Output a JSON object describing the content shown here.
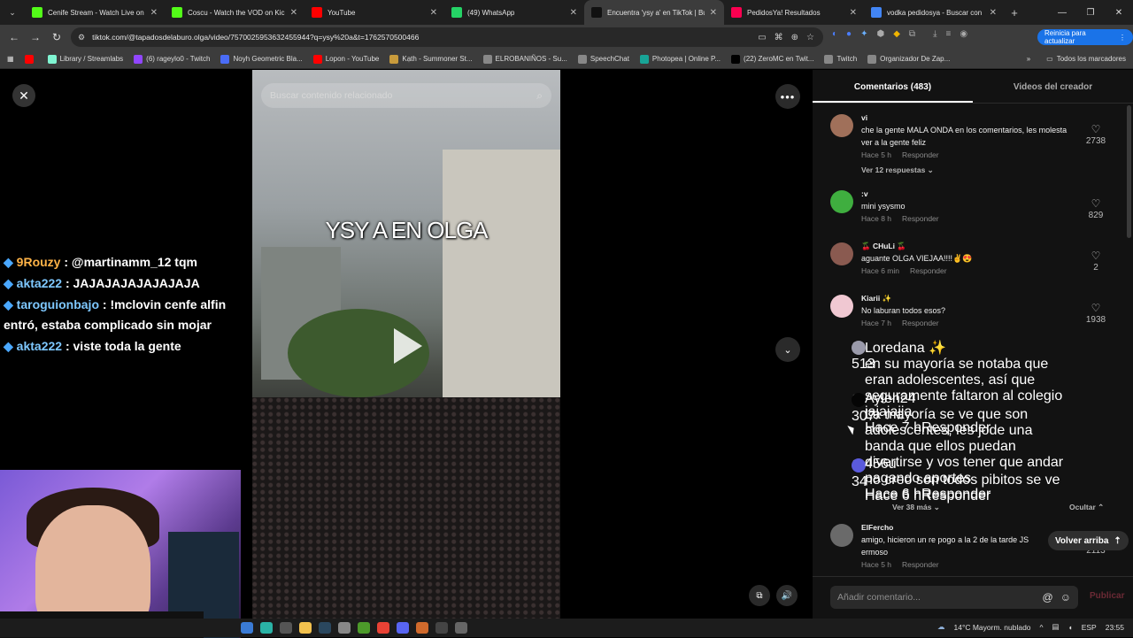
{
  "tabs": [
    {
      "title": "Cenife Stream - Watch Live on",
      "color": "#53fc18",
      "active": false
    },
    {
      "title": "Coscu - Watch the VOD on Kick",
      "color": "#53fc18",
      "active": false
    },
    {
      "title": "YouTube",
      "color": "#ff0000",
      "active": false
    },
    {
      "title": "(49) WhatsApp",
      "color": "#25d366",
      "active": false
    },
    {
      "title": "Encuentra 'ysy a' en TikTok | Bu",
      "color": "#111111",
      "active": true
    },
    {
      "title": "PedidosYa! Resultados",
      "color": "#fa0050",
      "active": false
    },
    {
      "title": "vodka pedidosya - Buscar con",
      "color": "#4285f4",
      "active": false
    }
  ],
  "address": {
    "url": "tiktok.com/@tapadosdelaburo.olga/video/7570025953632455944?q=ysy%20a&t=1762570500466",
    "update_label": "Reinicia para actualizar"
  },
  "bookmarks": [
    {
      "label": "",
      "color": "#ff0000"
    },
    {
      "label": "Library / Streamlabs",
      "color": "#80f5d2"
    },
    {
      "label": "(6) rageylo0 - Twitch",
      "color": "#9146ff"
    },
    {
      "label": "Noyh Geometric Bla...",
      "color": "#4a6cf7"
    },
    {
      "label": "Lopon - YouTube",
      "color": "#ff0000"
    },
    {
      "label": "Kạth - Summoner St...",
      "color": "#c89b3c"
    },
    {
      "label": "ELROBANIÑOS - Su...",
      "color": "#888888"
    },
    {
      "label": "SpeechChat",
      "color": "#888888"
    },
    {
      "label": "Photopea | Online P...",
      "color": "#18a497"
    },
    {
      "label": "(22) ZeroMC en Twit...",
      "color": "#000000"
    },
    {
      "label": "Twitch",
      "color": "#888888"
    },
    {
      "label": "Organizador De Zap...",
      "color": "#888888"
    }
  ],
  "bookmarks_all": "Todos los marcadores",
  "stream_chat": [
    {
      "user": "9Rouzy",
      "msg": "@martinamm_12 tqm",
      "gold": true
    },
    {
      "user": "akta222",
      "msg": "JAJAJAJAJAJAJAJA",
      "gold": false
    },
    {
      "user": "taroguionbajo",
      "msg": "!mclovin cenfe alfin entró, estaba complicado sin mojar",
      "gold": false
    },
    {
      "user": "akta222",
      "msg": "viste toda la gente",
      "gold": false
    }
  ],
  "video": {
    "search_placeholder": "Buscar contenido relacionado",
    "caption": "YSY A EN OLGA"
  },
  "panel": {
    "tab_comments": "Comentarios (483)",
    "tab_videos": "Videos del creador",
    "reply_label": "Responder",
    "back_to_top": "Volver arriba",
    "comment_placeholder": "Añadir comentario...",
    "publish": "Publicar"
  },
  "comments": [
    {
      "name": "vi",
      "text": "che la gente MALA ONDA en los comentarios, les molesta ver a la gente feliz",
      "time": "Hace 5 h",
      "likes": "2738",
      "avatar": "#a0705a",
      "view": "Ver 12 respuestas"
    },
    {
      "name": ":v",
      "text": "mini ysysmo",
      "time": "Hace 8 h",
      "likes": "829",
      "avatar": "#3fae3f",
      "view": ""
    },
    {
      "name": "🍒 CHuLi 🍒",
      "text": "aguante OLGA VIEJAA!!!!✌️😍",
      "time": "Hace 6 min",
      "likes": "2",
      "avatar": "#8a5a50",
      "view": ""
    },
    {
      "name": "Kiarii ✨",
      "text": "No laburan todos esos?",
      "time": "Hace 7 h",
      "likes": "1938",
      "avatar": "#f0c8d2",
      "view": ""
    },
    {
      "name": "ElFercho",
      "text": "amigo, hicieron un re pogo a la 2 de la tarde JS",
      "text2": "ermoso",
      "time": "Hace 5 h",
      "likes": "2113",
      "avatar": "#6a6a6a",
      "view": ""
    }
  ],
  "replies": [
    {
      "name": "Loredana ✨",
      "text": "en su mayoría se notaba que eran adolescentes, así que seguramente faltaron al colegio jajajajja",
      "time": "Hace 7 h",
      "likes": "513",
      "avatar": "#9a9aaa"
    },
    {
      "name": "Aylen24",
      "text": "La mayoría se ve que son adolescentes, les jode una banda que ellos puedan divertirse y vos tener que andar pagando aportes",
      "time": "Hace 6 h",
      "likes": "307",
      "avatar": "#050505"
    },
    {
      "name": "456u",
      "text": "no creo son todos pibitos se ve",
      "time": "Hace 6 h",
      "likes": "34",
      "avatar": "#5a5adc"
    }
  ],
  "replies_more": "Ver 38 más",
  "replies_hide": "Ocultar",
  "taskbar": {
    "weather": "14°C  Mayorm. nublado",
    "lang": "ESP",
    "time": "23:55"
  }
}
